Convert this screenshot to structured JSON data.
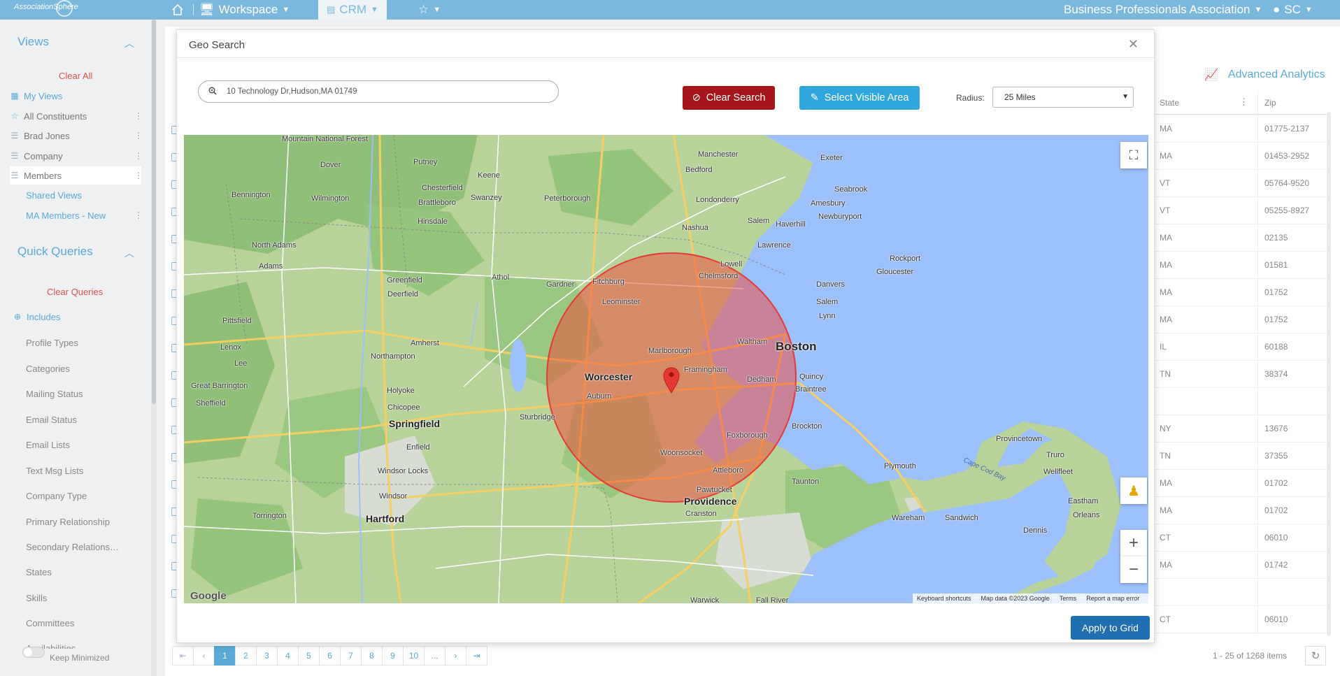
{
  "topbar": {
    "logo": "AssociationSphere",
    "workspace": "Workspace",
    "crm": "CRM",
    "org": "Business Professionals Association",
    "user": "SC"
  },
  "sidebar": {
    "views_title": "Views",
    "clear_all": "Clear All",
    "views": [
      {
        "label": "My Views",
        "icon": "grid-icon"
      },
      {
        "label": "All Constituents",
        "icon": "star-icon"
      },
      {
        "label": "Brad Jones",
        "icon": "list-icon"
      },
      {
        "label": "Company",
        "icon": "list-icon"
      },
      {
        "label": "Members",
        "icon": "list-icon"
      },
      {
        "label": "Shared Views",
        "icon": ""
      },
      {
        "label": "MA Members - New",
        "icon": ""
      }
    ],
    "quick_queries_title": "Quick Queries",
    "clear_queries": "Clear Queries",
    "includes": "Includes",
    "queries": [
      "Profile Types",
      "Categories",
      "Mailing Status",
      "Email Status",
      "Email Lists",
      "Text Msg Lists",
      "Company Type",
      "Primary Relationship",
      "Secondary Relations…",
      "States",
      "Skills",
      "Committees",
      "Availabilities"
    ],
    "keep_minimized": "Keep Minimized"
  },
  "background": {
    "advanced_analytics": "Advanced Analytics",
    "columns": [
      "State",
      "Zip"
    ],
    "rows": [
      [
        "MA",
        "01775-2137"
      ],
      [
        "MA",
        "01453-2952"
      ],
      [
        "VT",
        "05764-9520"
      ],
      [
        "VT",
        "05255-8927"
      ],
      [
        "MA",
        "02135"
      ],
      [
        "MA",
        "01581"
      ],
      [
        "MA",
        "01752"
      ],
      [
        "MA",
        "01752"
      ],
      [
        "IL",
        "60188"
      ],
      [
        "TN",
        "38374"
      ],
      [
        "",
        ""
      ],
      [
        "NY",
        "13676"
      ],
      [
        "TN",
        "37355"
      ],
      [
        "MA",
        "01702"
      ],
      [
        "MA",
        "01702"
      ],
      [
        "CT",
        "06010"
      ],
      [
        "MA",
        "01742"
      ],
      [
        "",
        ""
      ],
      [
        "CT",
        "06010"
      ]
    ],
    "pages": [
      "1",
      "2",
      "3",
      "4",
      "5",
      "6",
      "7",
      "8",
      "9",
      "10",
      "..."
    ],
    "items_count": "1 - 25 of 1268 items"
  },
  "modal": {
    "title": "Geo Search",
    "search_value": "10 Technology Dr,Hudson,MA 01749",
    "clear_search": "Clear Search",
    "select_visible": "Select Visible Area",
    "radius_label": "Radius:",
    "radius_value": "25 Miles",
    "apply": "Apply to Grid"
  },
  "map": {
    "labels": [
      "Mountain National Forest",
      "Dover",
      "Putney",
      "Keene",
      "Manchester",
      "Exeter",
      "Bedford",
      "Seabrook",
      "Amesbury",
      "Newburyport",
      "Chesterfield",
      "Swanzey",
      "Peterborough",
      "Londonderry",
      "Bennington",
      "Wilmington",
      "Brattleboro",
      "Hinsdale",
      "Nashua",
      "Salem",
      "Haverhill",
      "North Adams",
      "Adams",
      "Lawrence",
      "Lowell",
      "Chelmsford",
      "Rockport",
      "Gloucester",
      "Greenfield",
      "Athol",
      "Gardner",
      "Fitchburg",
      "Danvers",
      "Deerfield",
      "Leominster",
      "Salem",
      "Pittsfield",
      "Lynn",
      "Amherst",
      "Marlborough",
      "Waltham",
      "Boston",
      "Lenox",
      "Lee",
      "Northampton",
      "Framingham",
      "Worcester",
      "Quincy",
      "Great Barrington",
      "Holyoke",
      "Dedham",
      "Braintree",
      "Auburn",
      "Sheffield",
      "Chicopee",
      "Springfield",
      "Sturbridge",
      "Foxborough",
      "Brockton",
      "Enfield",
      "Woonsocket",
      "Provincetown",
      "Truro",
      "Wellfleet",
      "Windsor Locks",
      "Attleboro",
      "Plymouth",
      "Windsor",
      "Pawtucket",
      "Taunton",
      "Eastham",
      "Torrington",
      "Hartford",
      "Providence",
      "Orleans",
      "Cranston",
      "Wareham",
      "Sandwich",
      "Dennis",
      "Warwick",
      "Fall River"
    ],
    "water_label": "Cape Cod Bay",
    "attribution": [
      "Keyboard shortcuts",
      "Map data ©2023 Google",
      "Terms",
      "Report a map error"
    ],
    "google": "Google"
  }
}
